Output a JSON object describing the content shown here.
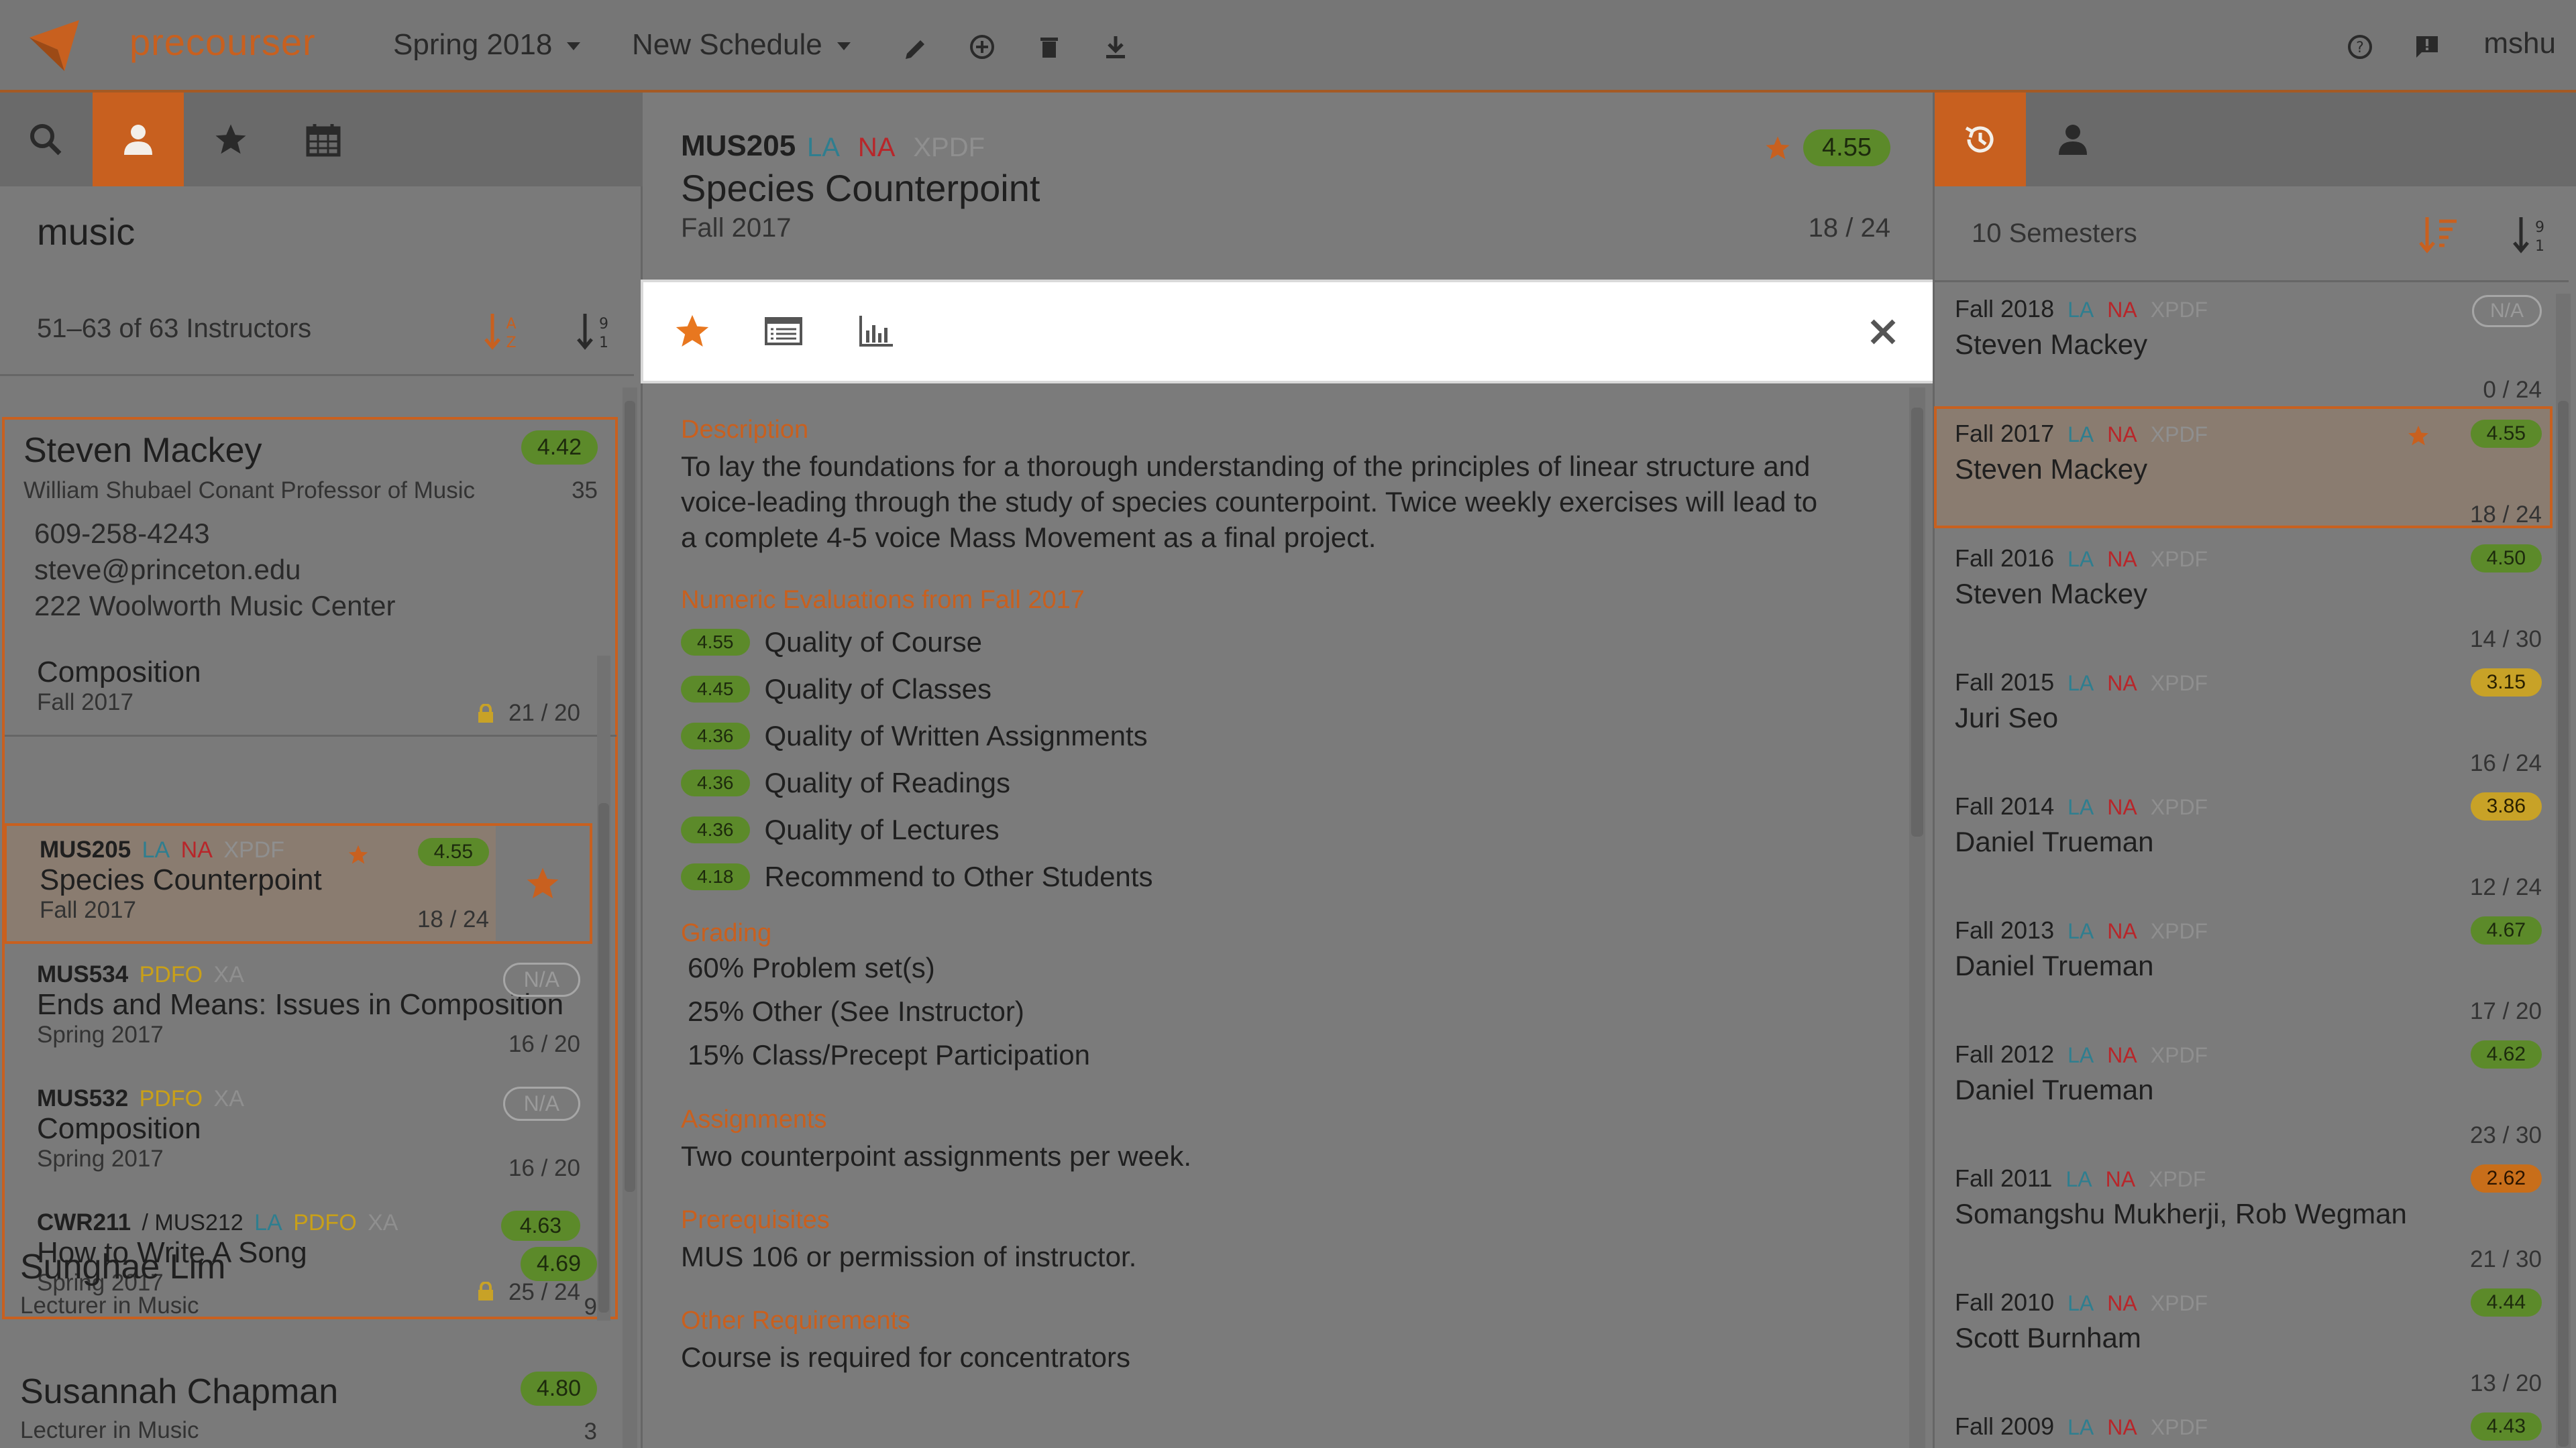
{
  "app": {
    "brand": "precourser",
    "semester": "Spring 2018",
    "schedule": "New Schedule",
    "user": "mshu"
  },
  "colors": {
    "accent": "#c8601f",
    "rating_green": "#5c8a2a",
    "rating_yellow": "#c8a227",
    "rating_orange": "#c86e1a"
  },
  "left": {
    "query": "music",
    "count": "51–63 of 63 Instructors",
    "instructor": {
      "name": "Steven Mackey",
      "title": "William Shubael Conant Professor of Music",
      "rating": "4.42",
      "courses": "35",
      "phone": "609-258-4243",
      "email": "steve@princeton.edu",
      "office": "222 Woolworth Music Center"
    },
    "courses": [
      {
        "title": "Composition",
        "semester": "Fall 2017",
        "frac": "21 / 20"
      },
      {
        "code": "MUS205",
        "d1": "LA",
        "d2": "NA",
        "d3": "XPDF",
        "rating": "4.55",
        "title": "Species Counterpoint",
        "semester": "Fall 2017",
        "frac": "18 / 24"
      },
      {
        "code": "MUS534",
        "d1": "PDFO",
        "d2": "XA",
        "rating": "N/A",
        "title": "Ends and Means: Issues in Composition",
        "semester": "Spring 2017",
        "frac": "16 / 20"
      },
      {
        "code": "MUS532",
        "d1": "PDFO",
        "d2": "XA",
        "rating": "N/A",
        "title": "Composition",
        "semester": "Spring 2017",
        "frac": "16 / 20"
      },
      {
        "code": "CWR211",
        "cross": "/ MUS212",
        "d1": "LA",
        "d2": "PDFO",
        "d3": "XA",
        "rating": "4.63",
        "title": "How to Write A Song",
        "semester": "Spring 2017",
        "frac": "25 / 24"
      }
    ],
    "others": [
      {
        "name": "Sunghae Lim",
        "title": "Lecturer in Music",
        "rating": "4.69",
        "count": "9"
      },
      {
        "name": "Susannah Chapman",
        "title": "Lecturer in Music",
        "rating": "4.80",
        "count": "3"
      }
    ]
  },
  "center": {
    "code": "MUS205",
    "d1": "LA",
    "d2": "NA",
    "d3": "XPDF",
    "title": "Species Counterpoint",
    "semester": "Fall 2017",
    "frac": "18 / 24",
    "rating": "4.55",
    "description_label": "Description",
    "description": "To lay the foundations for a thorough understanding of the principles of linear structure and voice-leading through the study of species counterpoint. Twice weekly exercises will lead to a complete 4-5 voice Mass Movement as a final project.",
    "evals_label": "Numeric Evaluations from Fall 2017",
    "evals": [
      {
        "score": "4.55",
        "label": "Quality of Course"
      },
      {
        "score": "4.45",
        "label": "Quality of Classes"
      },
      {
        "score": "4.36",
        "label": "Quality of Written Assignments"
      },
      {
        "score": "4.36",
        "label": "Quality of Readings"
      },
      {
        "score": "4.36",
        "label": "Quality of Lectures"
      },
      {
        "score": "4.18",
        "label": "Recommend to Other Students"
      }
    ],
    "grading_label": "Grading",
    "grading": [
      "60% Problem set(s)",
      "25% Other (See Instructor)",
      "15% Class/Precept Participation"
    ],
    "assignments_label": "Assignments",
    "assignments": "Two counterpoint assignments per week.",
    "prereq_label": "Prerequisites",
    "prereq": "MUS 106 or permission of instructor.",
    "other_label": "Other Requirements",
    "other": "Course is required for concentrators"
  },
  "right": {
    "count": "10 Semesters",
    "semesters": [
      {
        "sem": "Fall 2018",
        "inst": "Steven Mackey",
        "rating": "N/A",
        "frac": "0 / 24"
      },
      {
        "sem": "Fall 2017",
        "inst": "Steven Mackey",
        "rating": "4.55",
        "frac": "18 / 24"
      },
      {
        "sem": "Fall 2016",
        "inst": "Steven Mackey",
        "rating": "4.50",
        "frac": "14 / 30"
      },
      {
        "sem": "Fall 2015",
        "inst": "Juri Seo",
        "rating": "3.15",
        "frac": "16 / 24"
      },
      {
        "sem": "Fall 2014",
        "inst": "Daniel Trueman",
        "rating": "3.86",
        "frac": "12 / 24"
      },
      {
        "sem": "Fall 2013",
        "inst": "Daniel Trueman",
        "rating": "4.67",
        "frac": "17 / 20"
      },
      {
        "sem": "Fall 2012",
        "inst": "Daniel Trueman",
        "rating": "4.62",
        "frac": "23 / 30"
      },
      {
        "sem": "Fall 2011",
        "inst": "Somangshu Mukherji, Rob Wegman",
        "rating": "2.62",
        "frac": "21 / 30"
      },
      {
        "sem": "Fall 2010",
        "inst": "Scott Burnham",
        "rating": "4.44",
        "frac": "13 / 20"
      },
      {
        "sem": "Fall 2009",
        "inst": "",
        "rating": "4.43",
        "frac": ""
      }
    ],
    "dist": {
      "d1": "LA",
      "d2": "NA",
      "d3": "XPDF"
    }
  }
}
